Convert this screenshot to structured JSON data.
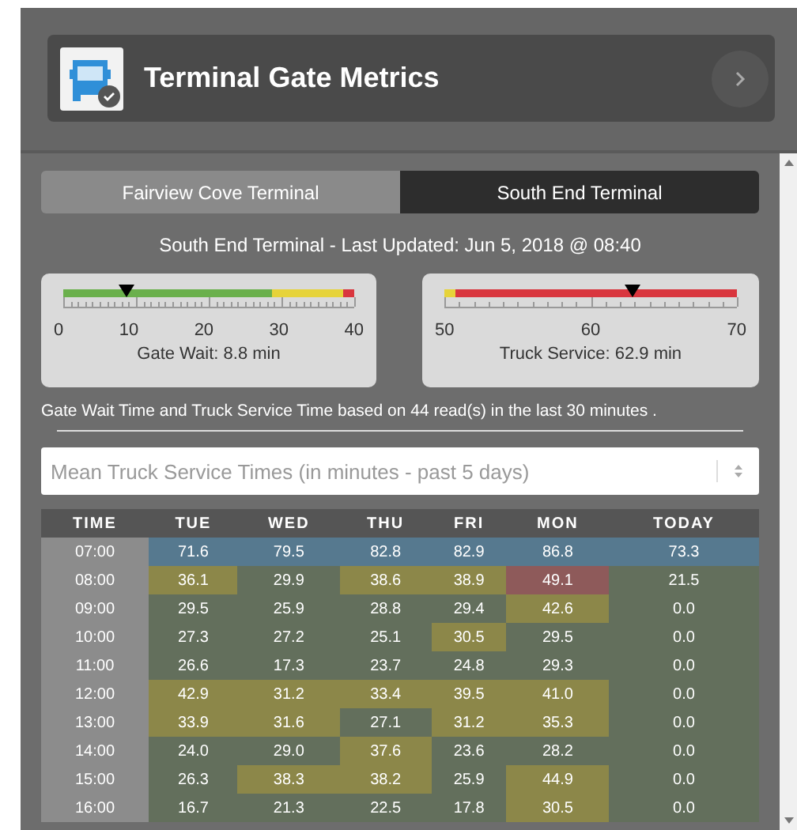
{
  "header": {
    "title": "Terminal Gate Metrics"
  },
  "tabs": [
    {
      "label": "Fairview Cove Terminal",
      "selected": false
    },
    {
      "label": "South End Terminal",
      "selected": true
    }
  ],
  "last_updated": "South End Terminal - Last Updated: Jun 5, 2018 @ 08:40",
  "gauges": [
    {
      "kind": "wait",
      "level": 0.22,
      "caption": "Gate Wait: 8.8 min",
      "ticks": [
        "0",
        "10",
        "20",
        "30",
        "40"
      ]
    },
    {
      "kind": "service",
      "level": 0.645,
      "caption": "Truck Service: 62.9 min",
      "ticks": [
        "50",
        "60",
        "70"
      ]
    }
  ],
  "note": "Gate Wait Time and Truck Service Time based on 44 read(s) in the last 30 minutes .",
  "select": {
    "value": "Mean Truck Service Times (in minutes - past 5 days)"
  },
  "table": {
    "columns": [
      "TIME",
      "TUE",
      "WED",
      "THU",
      "FRI",
      "MON",
      "TODAY"
    ],
    "rows": [
      {
        "cells": [
          {
            "kind": "time",
            "value": "07:00"
          },
          {
            "value": "71.6",
            "color": "#56798f"
          },
          {
            "value": "79.5",
            "color": "#56798f"
          },
          {
            "value": "82.8",
            "color": "#56798f"
          },
          {
            "value": "82.9",
            "color": "#56798f"
          },
          {
            "value": "86.8",
            "color": "#56798f"
          },
          {
            "value": "73.3",
            "color": "#56798f"
          }
        ]
      },
      {
        "cells": [
          {
            "kind": "time",
            "value": "08:00"
          },
          {
            "value": "36.1",
            "color": "#8c8749"
          },
          {
            "value": "29.9",
            "color": "#636f5c"
          },
          {
            "value": "38.6",
            "color": "#8c8749"
          },
          {
            "value": "38.9",
            "color": "#8c8749"
          },
          {
            "value": "49.1",
            "color": "#8e5a5a"
          },
          {
            "value": "21.5",
            "color": "#636f5c"
          }
        ]
      },
      {
        "cells": [
          {
            "kind": "time",
            "value": "09:00"
          },
          {
            "value": "29.5",
            "color": "#636f5c"
          },
          {
            "value": "25.9",
            "color": "#636f5c"
          },
          {
            "value": "28.8",
            "color": "#636f5c"
          },
          {
            "value": "29.4",
            "color": "#636f5c"
          },
          {
            "value": "42.6",
            "color": "#8c8749"
          },
          {
            "value": "0.0",
            "color": "#636f5c"
          }
        ]
      },
      {
        "cells": [
          {
            "kind": "time",
            "value": "10:00"
          },
          {
            "value": "27.3",
            "color": "#636f5c"
          },
          {
            "value": "27.2",
            "color": "#636f5c"
          },
          {
            "value": "25.1",
            "color": "#636f5c"
          },
          {
            "value": "30.5",
            "color": "#8c8749"
          },
          {
            "value": "29.5",
            "color": "#636f5c"
          },
          {
            "value": "0.0",
            "color": "#636f5c"
          }
        ]
      },
      {
        "cells": [
          {
            "kind": "time",
            "value": "11:00"
          },
          {
            "value": "26.6",
            "color": "#636f5c"
          },
          {
            "value": "17.3",
            "color": "#636f5c"
          },
          {
            "value": "23.7",
            "color": "#636f5c"
          },
          {
            "value": "24.8",
            "color": "#636f5c"
          },
          {
            "value": "29.3",
            "color": "#636f5c"
          },
          {
            "value": "0.0",
            "color": "#636f5c"
          }
        ]
      },
      {
        "cells": [
          {
            "kind": "time",
            "value": "12:00"
          },
          {
            "value": "42.9",
            "color": "#8c8749"
          },
          {
            "value": "31.2",
            "color": "#8c8749"
          },
          {
            "value": "33.4",
            "color": "#8c8749"
          },
          {
            "value": "39.5",
            "color": "#8c8749"
          },
          {
            "value": "41.0",
            "color": "#8c8749"
          },
          {
            "value": "0.0",
            "color": "#636f5c"
          }
        ]
      },
      {
        "cells": [
          {
            "kind": "time",
            "value": "13:00"
          },
          {
            "value": "33.9",
            "color": "#8c8749"
          },
          {
            "value": "31.6",
            "color": "#8c8749"
          },
          {
            "value": "27.1",
            "color": "#636f5c"
          },
          {
            "value": "31.2",
            "color": "#8c8749"
          },
          {
            "value": "35.3",
            "color": "#8c8749"
          },
          {
            "value": "0.0",
            "color": "#636f5c"
          }
        ]
      },
      {
        "cells": [
          {
            "kind": "time",
            "value": "14:00"
          },
          {
            "value": "24.0",
            "color": "#636f5c"
          },
          {
            "value": "29.0",
            "color": "#636f5c"
          },
          {
            "value": "37.6",
            "color": "#8c8749"
          },
          {
            "value": "23.6",
            "color": "#636f5c"
          },
          {
            "value": "28.2",
            "color": "#636f5c"
          },
          {
            "value": "0.0",
            "color": "#636f5c"
          }
        ]
      },
      {
        "cells": [
          {
            "kind": "time",
            "value": "15:00"
          },
          {
            "value": "26.3",
            "color": "#636f5c"
          },
          {
            "value": "38.3",
            "color": "#8c8749"
          },
          {
            "value": "38.2",
            "color": "#8c8749"
          },
          {
            "value": "25.9",
            "color": "#636f5c"
          },
          {
            "value": "44.9",
            "color": "#8c8749"
          },
          {
            "value": "0.0",
            "color": "#636f5c"
          }
        ]
      },
      {
        "cells": [
          {
            "kind": "time",
            "value": "16:00"
          },
          {
            "value": "16.7",
            "color": "#636f5c"
          },
          {
            "value": "21.3",
            "color": "#636f5c"
          },
          {
            "value": "22.5",
            "color": "#636f5c"
          },
          {
            "value": "17.8",
            "color": "#636f5c"
          },
          {
            "value": "30.5",
            "color": "#8c8749"
          },
          {
            "value": "0.0",
            "color": "#636f5c"
          }
        ]
      }
    ]
  }
}
